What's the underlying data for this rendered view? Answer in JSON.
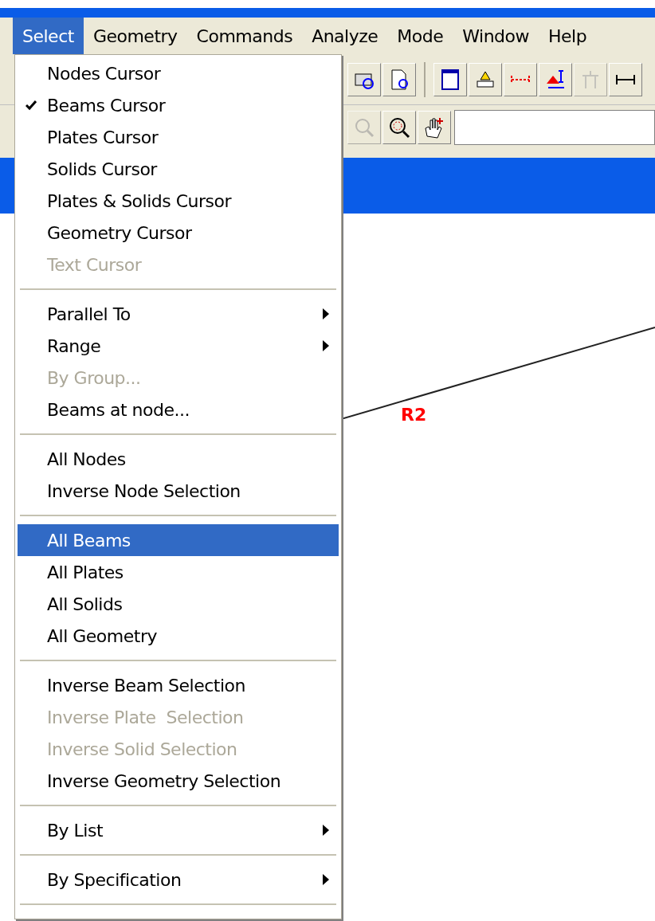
{
  "menubar": [
    {
      "label": "Select",
      "selected": true
    },
    {
      "label": "Geometry",
      "selected": false
    },
    {
      "label": "Commands",
      "selected": false
    },
    {
      "label": "Analyze",
      "selected": false
    },
    {
      "label": "Mode",
      "selected": false
    },
    {
      "label": "Window",
      "selected": false
    },
    {
      "label": "Help",
      "selected": false
    }
  ],
  "menu": {
    "sections": [
      {
        "items": [
          {
            "label": "Nodes Cursor",
            "kind": "command",
            "checked": false,
            "disabled": false,
            "selected": false
          },
          {
            "label": "Beams Cursor",
            "kind": "command",
            "checked": true,
            "disabled": false,
            "selected": false
          },
          {
            "label": "Plates Cursor",
            "kind": "command",
            "checked": false,
            "disabled": false,
            "selected": false
          },
          {
            "label": "Solids Cursor",
            "kind": "command",
            "checked": false,
            "disabled": false,
            "selected": false
          },
          {
            "label": "Plates & Solids Cursor",
            "kind": "command",
            "checked": false,
            "disabled": false,
            "selected": false
          },
          {
            "label": "Geometry Cursor",
            "kind": "command",
            "checked": false,
            "disabled": false,
            "selected": false
          },
          {
            "label": "Text Cursor",
            "kind": "command",
            "checked": false,
            "disabled": true,
            "selected": false
          }
        ]
      },
      {
        "items": [
          {
            "label": "Parallel To",
            "kind": "submenu",
            "checked": false,
            "disabled": false,
            "selected": false
          },
          {
            "label": "Range",
            "kind": "submenu",
            "checked": false,
            "disabled": false,
            "selected": false
          },
          {
            "label": "By Group...",
            "kind": "command",
            "checked": false,
            "disabled": true,
            "selected": false
          },
          {
            "label": "Beams at node...",
            "kind": "command",
            "checked": false,
            "disabled": false,
            "selected": false
          }
        ]
      },
      {
        "items": [
          {
            "label": "All Nodes",
            "kind": "command",
            "checked": false,
            "disabled": false,
            "selected": false
          },
          {
            "label": "Inverse Node Selection",
            "kind": "command",
            "checked": false,
            "disabled": false,
            "selected": false
          }
        ]
      },
      {
        "items": [
          {
            "label": "All Beams",
            "kind": "command",
            "checked": false,
            "disabled": false,
            "selected": true
          },
          {
            "label": "All Plates",
            "kind": "command",
            "checked": false,
            "disabled": false,
            "selected": false
          },
          {
            "label": "All Solids",
            "kind": "command",
            "checked": false,
            "disabled": false,
            "selected": false
          },
          {
            "label": "All Geometry",
            "kind": "command",
            "checked": false,
            "disabled": false,
            "selected": false
          }
        ]
      },
      {
        "items": [
          {
            "label": "Inverse Beam Selection",
            "kind": "command",
            "checked": false,
            "disabled": false,
            "selected": false
          },
          {
            "label": "Inverse Plate  Selection",
            "kind": "command",
            "checked": false,
            "disabled": true,
            "selected": false
          },
          {
            "label": "Inverse Solid Selection",
            "kind": "command",
            "checked": false,
            "disabled": true,
            "selected": false
          },
          {
            "label": "Inverse Geometry Selection",
            "kind": "command",
            "checked": false,
            "disabled": false,
            "selected": false
          }
        ]
      },
      {
        "items": [
          {
            "label": "By List",
            "kind": "submenu",
            "checked": false,
            "disabled": false,
            "selected": false
          }
        ]
      },
      {
        "items": [
          {
            "label": "By Specification",
            "kind": "submenu",
            "checked": false,
            "disabled": false,
            "selected": false
          }
        ]
      }
    ]
  },
  "canvas": {
    "beam_label": "R2"
  }
}
